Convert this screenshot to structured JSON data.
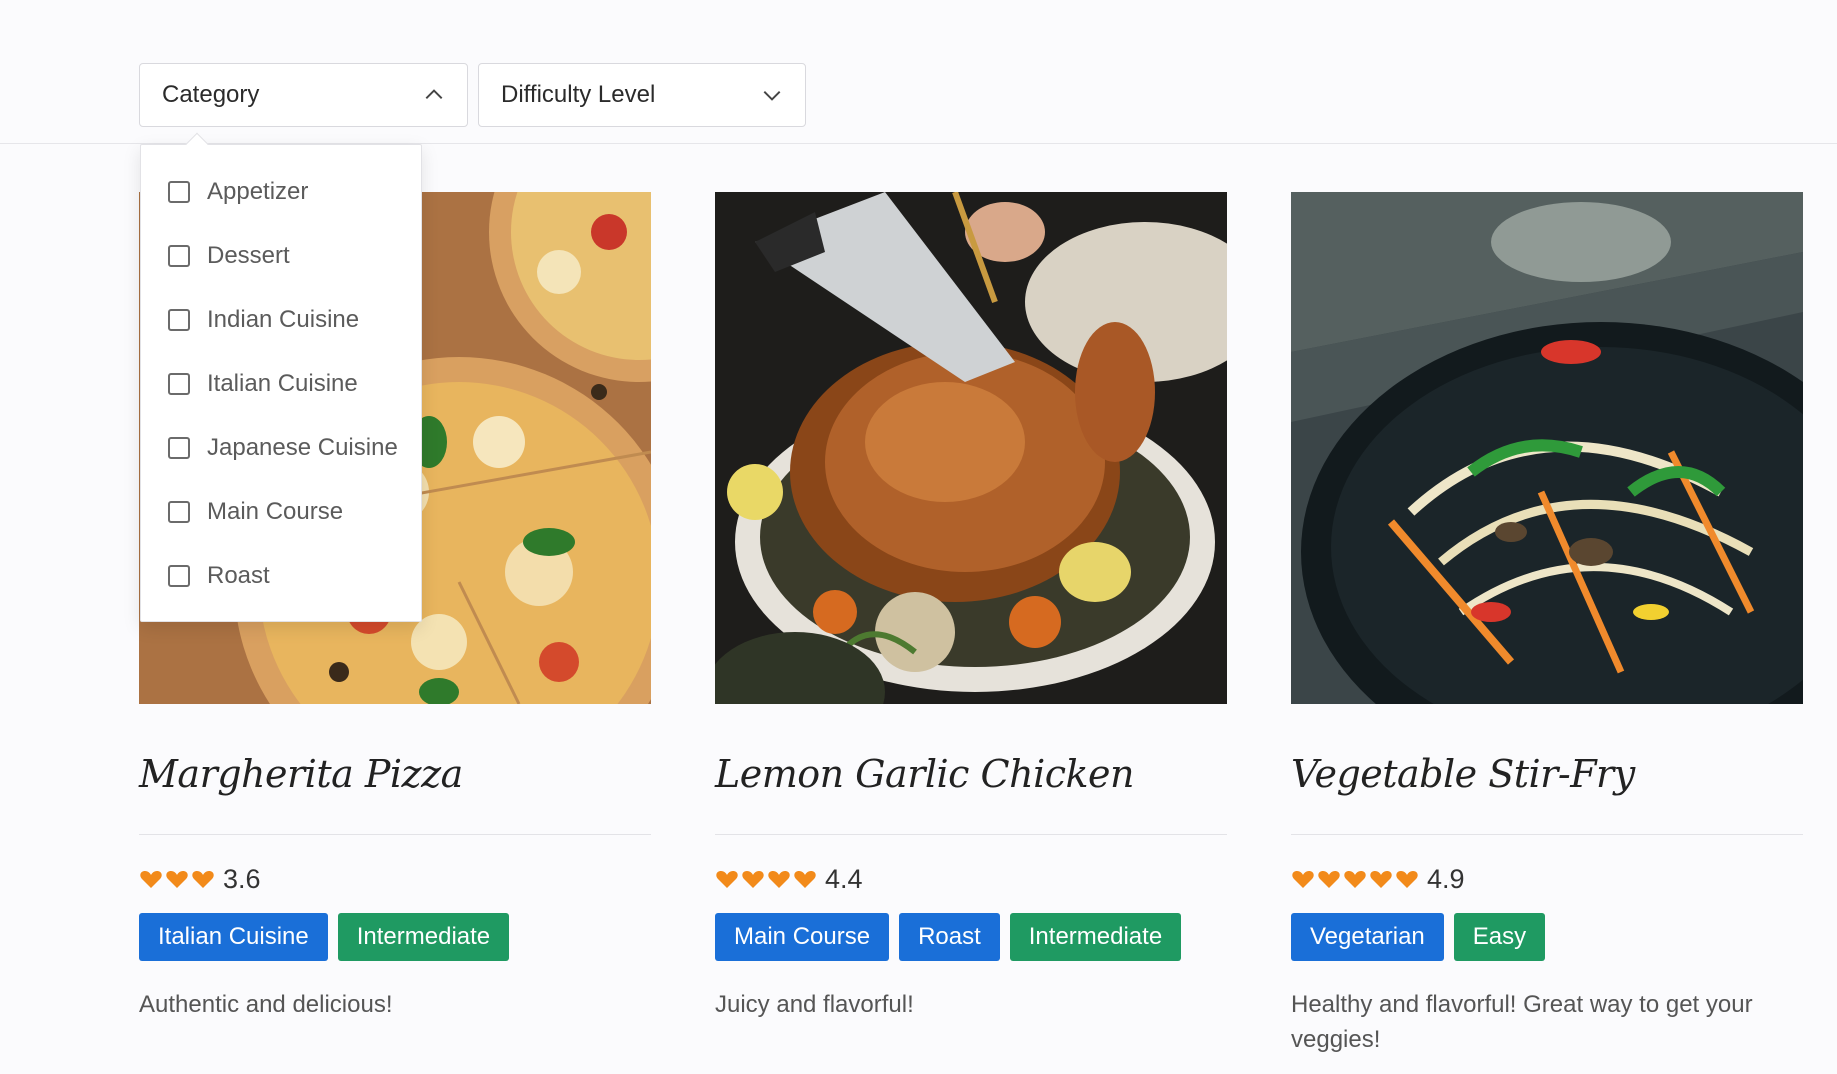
{
  "filters": {
    "category": {
      "label": "Category",
      "expanded": true
    },
    "difficulty": {
      "label": "Difficulty Level",
      "expanded": false
    }
  },
  "category_options": [
    "Appetizer",
    "Dessert",
    "Indian Cuisine",
    "Italian Cuisine",
    "Japanese Cuisine",
    "Main Course",
    "Roast"
  ],
  "recipes": [
    {
      "title": "Margherita Pizza",
      "rating": "3.6",
      "hearts": 3,
      "tags": [
        {
          "label": "Italian Cuisine",
          "color": "#1a6fd8"
        },
        {
          "label": "Intermediate",
          "color": "#1f9a62"
        }
      ],
      "description": "Authentic and delicious!"
    },
    {
      "title": "Lemon Garlic Chicken",
      "rating": "4.4",
      "hearts": 4,
      "tags": [
        {
          "label": "Main Course",
          "color": "#1a6fd8"
        },
        {
          "label": "Roast",
          "color": "#1a6fd8"
        },
        {
          "label": "Intermediate",
          "color": "#1f9a62"
        }
      ],
      "description": "Juicy and flavorful!"
    },
    {
      "title": "Vegetable Stir-Fry",
      "rating": "4.9",
      "hearts": 5,
      "tags": [
        {
          "label": "Vegetarian",
          "color": "#1a6fd8"
        },
        {
          "label": "Easy",
          "color": "#1f9a62"
        }
      ],
      "description": "Healthy and flavorful! Great way to get your veggies!"
    }
  ],
  "colors": {
    "heart": "#f28a1a",
    "tag_blue": "#1a6fd8",
    "tag_green": "#1f9a62"
  }
}
